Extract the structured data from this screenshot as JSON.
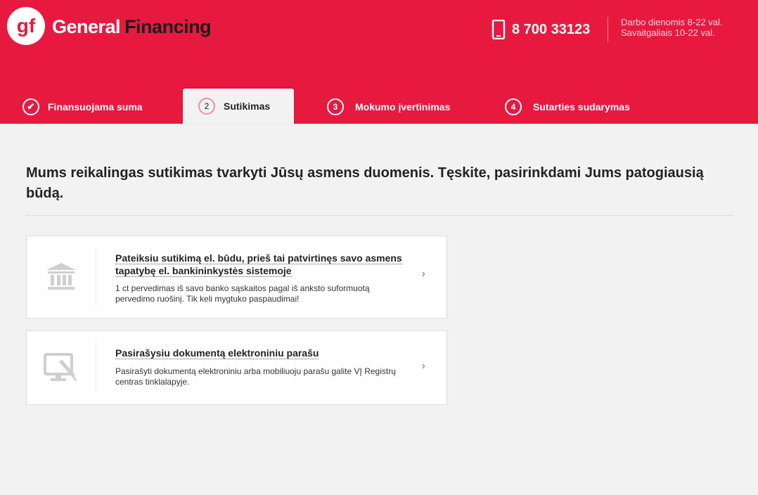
{
  "brand": {
    "logo_mark": "gf",
    "name_part1": "General",
    "name_part2": "Financing"
  },
  "contact": {
    "phone": "8 700 33123",
    "hours_weekdays": "Darbo dienomis 8-22 val.",
    "hours_weekend": "Savaitgaliais 10-22 val."
  },
  "steps": [
    {
      "number": "✔",
      "label": "Finansuojama suma",
      "state": "done"
    },
    {
      "number": "2",
      "label": "Sutikimas",
      "state": "active"
    },
    {
      "number": "3",
      "label": "Mokumo įvertinimas",
      "state": "upcoming"
    },
    {
      "number": "4",
      "label": "Sutarties sudarymas",
      "state": "upcoming"
    }
  ],
  "main": {
    "title": "Mums reikalingas sutikimas tvarkyti Jūsų asmens duomenis. Tęskite, pasirinkdami Jums patogiausią būdą.",
    "options": [
      {
        "icon": "bank-icon",
        "title": "Pateiksiu sutikimą el. būdu, prieš tai patvirtinęs savo asmens tapatybę el. bankininkystės sistemoje",
        "text": "1 ct pervedimas iš savo banko sąskaitos pagal iš anksto suformuotą pervedimo ruošinį. Tik keli mygtuko paspaudimai!"
      },
      {
        "icon": "monitor-signature-icon",
        "title": "Pasirašysiu dokumentą elektroniniu parašu",
        "text": "Pasirašyti dokumentą elektroniniu arba mobiliuoju parašu galite VĮ Registrų centras tinklalapyje."
      }
    ]
  },
  "colors": {
    "brand_red": "#e8193f",
    "brand_dark": "#1d1d1d",
    "background": "#f2f2f2"
  }
}
